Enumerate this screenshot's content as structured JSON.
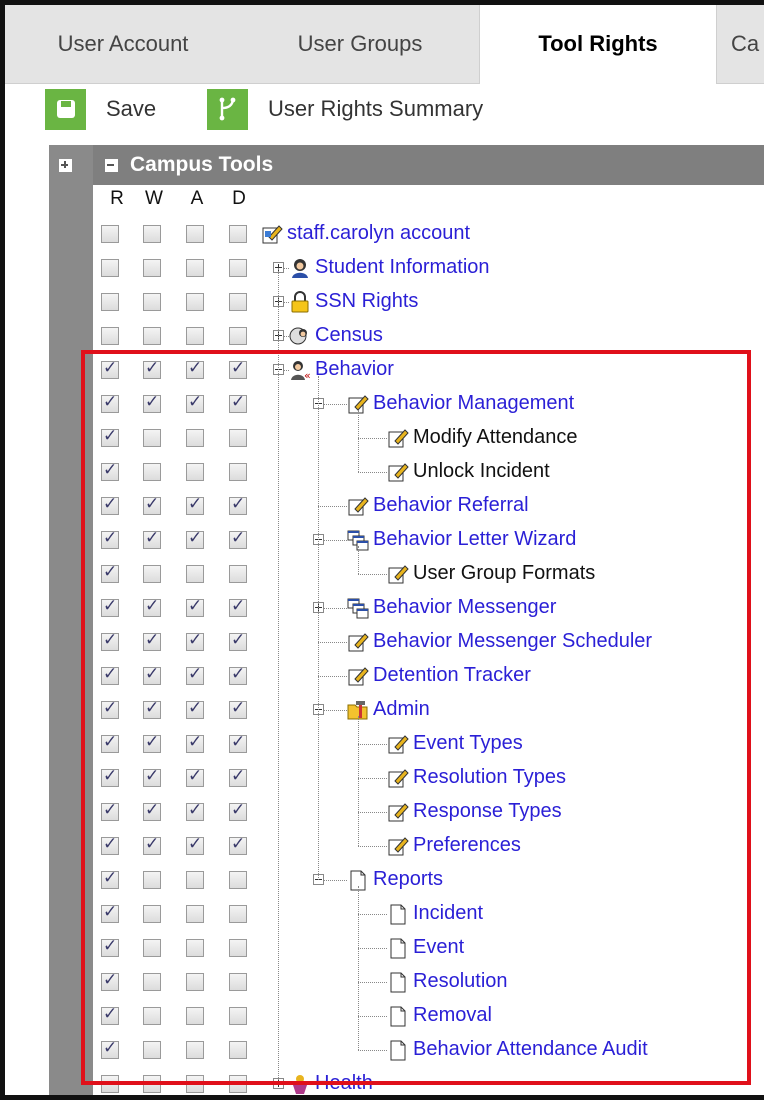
{
  "tabs": [
    {
      "label": "User Account",
      "active": false
    },
    {
      "label": "User Groups",
      "active": false
    },
    {
      "label": "Tool Rights",
      "active": true
    },
    {
      "label": "Ca",
      "active": false
    }
  ],
  "toolbar": {
    "save_label": "Save",
    "summary_label": "User Rights Summary"
  },
  "tree": {
    "header": "Campus Tools",
    "columns": [
      "R",
      "W",
      "A",
      "D"
    ],
    "rows": [
      {
        "label": "staff.carolyn account",
        "level": 0,
        "toggle": "none",
        "icon": "edit-account-icon",
        "style": "link",
        "checks": [
          false,
          false,
          false,
          false
        ]
      },
      {
        "label": "Student Information",
        "level": 1,
        "toggle": "plus",
        "icon": "person-icon",
        "style": "link",
        "checks": [
          false,
          false,
          false,
          false
        ]
      },
      {
        "label": "SSN Rights",
        "level": 1,
        "toggle": "plus",
        "icon": "lock-icon",
        "style": "link",
        "checks": [
          false,
          false,
          false,
          false
        ]
      },
      {
        "label": "Census",
        "level": 1,
        "toggle": "plus",
        "icon": "census-icon",
        "style": "link",
        "checks": [
          false,
          false,
          false,
          false
        ]
      },
      {
        "label": "Behavior",
        "level": 1,
        "toggle": "minus",
        "icon": "behavior-icon",
        "style": "link",
        "checks": [
          true,
          true,
          true,
          true
        ]
      },
      {
        "label": "Behavior Management",
        "level": 2,
        "toggle": "minus",
        "icon": "edit-icon",
        "style": "link",
        "checks": [
          true,
          true,
          true,
          true
        ]
      },
      {
        "label": "Modify Attendance",
        "level": 3,
        "toggle": "none",
        "icon": "edit-icon",
        "style": "plain",
        "checks": [
          true,
          false,
          false,
          false
        ]
      },
      {
        "label": "Unlock Incident",
        "level": 3,
        "toggle": "none",
        "icon": "edit-icon",
        "style": "plain",
        "checks": [
          true,
          false,
          false,
          false
        ]
      },
      {
        "label": "Behavior Referral",
        "level": 2,
        "toggle": "none",
        "icon": "edit-icon",
        "style": "link",
        "checks": [
          true,
          true,
          true,
          true
        ]
      },
      {
        "label": "Behavior Letter Wizard",
        "level": 2,
        "toggle": "minus",
        "icon": "windows-icon",
        "style": "link",
        "checks": [
          true,
          true,
          true,
          true
        ]
      },
      {
        "label": "User Group Formats",
        "level": 3,
        "toggle": "none",
        "icon": "edit-icon",
        "style": "plain",
        "checks": [
          true,
          false,
          false,
          false
        ]
      },
      {
        "label": "Behavior Messenger",
        "level": 2,
        "toggle": "plus",
        "icon": "windows-icon",
        "style": "link",
        "checks": [
          true,
          true,
          true,
          true
        ]
      },
      {
        "label": "Behavior Messenger Scheduler",
        "level": 2,
        "toggle": "none",
        "icon": "edit-icon",
        "style": "link",
        "checks": [
          true,
          true,
          true,
          true
        ]
      },
      {
        "label": "Detention Tracker",
        "level": 2,
        "toggle": "none",
        "icon": "edit-icon",
        "style": "link",
        "checks": [
          true,
          true,
          true,
          true
        ]
      },
      {
        "label": "Admin",
        "level": 2,
        "toggle": "minus",
        "icon": "admin-folder-icon",
        "style": "link",
        "checks": [
          true,
          true,
          true,
          true
        ]
      },
      {
        "label": "Event Types",
        "level": 3,
        "toggle": "none",
        "icon": "edit-icon",
        "style": "link",
        "checks": [
          true,
          true,
          true,
          true
        ]
      },
      {
        "label": "Resolution Types",
        "level": 3,
        "toggle": "none",
        "icon": "edit-icon",
        "style": "link",
        "checks": [
          true,
          true,
          true,
          true
        ]
      },
      {
        "label": "Response Types",
        "level": 3,
        "toggle": "none",
        "icon": "edit-icon",
        "style": "link",
        "checks": [
          true,
          true,
          true,
          true
        ]
      },
      {
        "label": "Preferences",
        "level": 3,
        "toggle": "none",
        "icon": "edit-icon",
        "style": "link",
        "checks": [
          true,
          true,
          true,
          true
        ]
      },
      {
        "label": "Reports",
        "level": 2,
        "toggle": "minus",
        "icon": "document-icon",
        "style": "link",
        "checks": [
          true,
          false,
          false,
          false
        ]
      },
      {
        "label": "Incident",
        "level": 3,
        "toggle": "none",
        "icon": "document-icon",
        "style": "link",
        "checks": [
          true,
          false,
          false,
          false
        ]
      },
      {
        "label": "Event",
        "level": 3,
        "toggle": "none",
        "icon": "document-icon",
        "style": "link",
        "checks": [
          true,
          false,
          false,
          false
        ]
      },
      {
        "label": "Resolution",
        "level": 3,
        "toggle": "none",
        "icon": "document-icon",
        "style": "link",
        "checks": [
          true,
          false,
          false,
          false
        ]
      },
      {
        "label": "Removal",
        "level": 3,
        "toggle": "none",
        "icon": "document-icon",
        "style": "link",
        "checks": [
          true,
          false,
          false,
          false
        ]
      },
      {
        "label": "Behavior Attendance Audit",
        "level": 3,
        "toggle": "none",
        "icon": "document-icon",
        "style": "link",
        "checks": [
          true,
          false,
          false,
          false
        ]
      },
      {
        "label": "Health",
        "level": 1,
        "toggle": "plus",
        "icon": "health-icon",
        "style": "link",
        "checks": [
          false,
          false,
          false,
          false
        ]
      }
    ]
  },
  "colors": {
    "accent_green": "#6ab543",
    "highlight_red": "#e0101a",
    "link_blue": "#2a1fd6"
  }
}
